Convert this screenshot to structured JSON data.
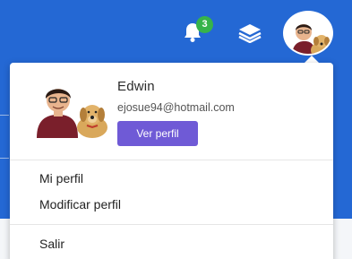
{
  "topbar": {
    "notification_count": "3",
    "bell_icon": "bell-icon",
    "layers_icon": "layers-icon",
    "accent": "#2468d4",
    "badge_color": "#37b34a"
  },
  "dropdown": {
    "user_name": "Edwin",
    "user_email": "ejosue94@hotmail.com",
    "view_profile_label": "Ver perfil",
    "button_color": "#6f5ad6",
    "menu": [
      {
        "label": "Mi perfil"
      },
      {
        "label": "Modificar perfil"
      },
      {
        "label": "Salir"
      }
    ]
  }
}
